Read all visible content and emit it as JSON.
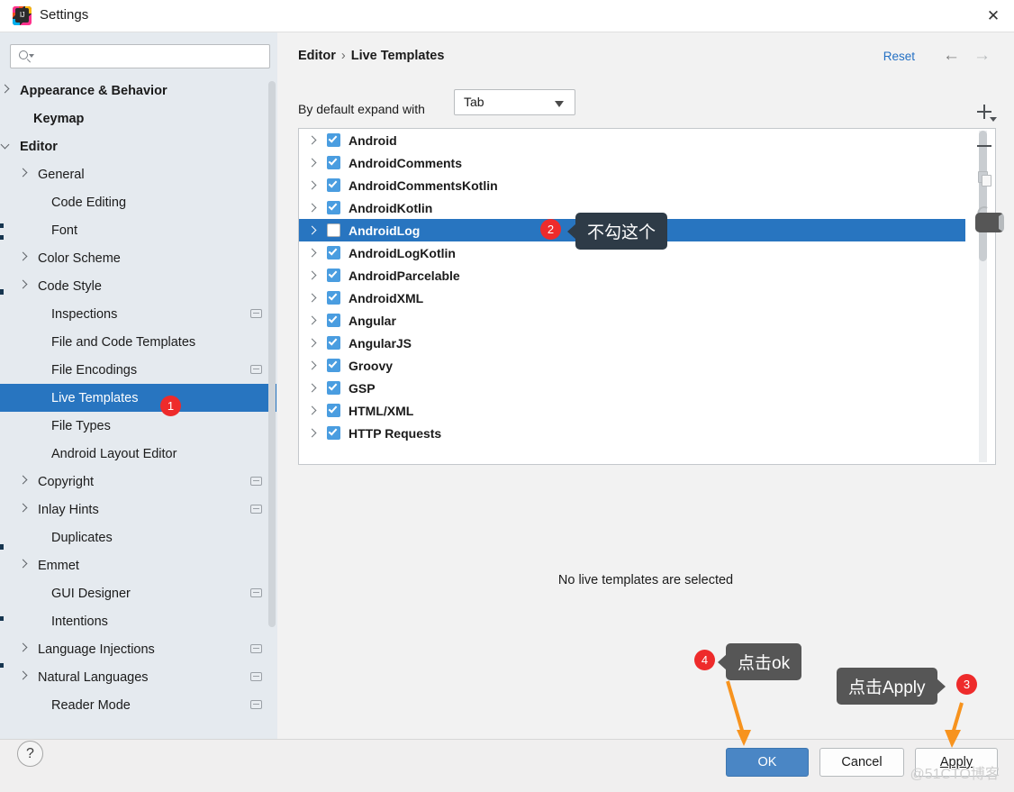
{
  "window": {
    "title": "Settings",
    "close_label": "✕",
    "app_icon": "intellij-idea-icon"
  },
  "sidebar": {
    "search": {
      "placeholder": "",
      "value": ""
    },
    "items": [
      {
        "label": "Appearance & Behavior",
        "indent": 22,
        "chevron": "right",
        "bold": true,
        "selected": false,
        "badge": false
      },
      {
        "label": "Keymap",
        "indent": 37,
        "chevron": "none",
        "bold": true,
        "selected": false,
        "badge": false
      },
      {
        "label": "Editor",
        "indent": 22,
        "chevron": "down",
        "bold": true,
        "selected": false,
        "badge": false
      },
      {
        "label": "General",
        "indent": 42,
        "chevron": "right",
        "bold": false,
        "selected": false,
        "badge": false
      },
      {
        "label": "Code Editing",
        "indent": 57,
        "chevron": "none",
        "bold": false,
        "selected": false,
        "badge": false
      },
      {
        "label": "Font",
        "indent": 57,
        "chevron": "none",
        "bold": false,
        "selected": false,
        "badge": false
      },
      {
        "label": "Color Scheme",
        "indent": 42,
        "chevron": "right",
        "bold": false,
        "selected": false,
        "badge": false
      },
      {
        "label": "Code Style",
        "indent": 42,
        "chevron": "right",
        "bold": false,
        "selected": false,
        "badge": false
      },
      {
        "label": "Inspections",
        "indent": 57,
        "chevron": "none",
        "bold": false,
        "selected": false,
        "badge": true
      },
      {
        "label": "File and Code Templates",
        "indent": 57,
        "chevron": "none",
        "bold": false,
        "selected": false,
        "badge": false
      },
      {
        "label": "File Encodings",
        "indent": 57,
        "chevron": "none",
        "bold": false,
        "selected": false,
        "badge": true
      },
      {
        "label": "Live Templates",
        "indent": 57,
        "chevron": "none",
        "bold": false,
        "selected": true,
        "badge": false
      },
      {
        "label": "File Types",
        "indent": 57,
        "chevron": "none",
        "bold": false,
        "selected": false,
        "badge": false
      },
      {
        "label": "Android Layout Editor",
        "indent": 57,
        "chevron": "none",
        "bold": false,
        "selected": false,
        "badge": false
      },
      {
        "label": "Copyright",
        "indent": 42,
        "chevron": "right",
        "bold": false,
        "selected": false,
        "badge": true
      },
      {
        "label": "Inlay Hints",
        "indent": 42,
        "chevron": "right",
        "bold": false,
        "selected": false,
        "badge": true
      },
      {
        "label": "Duplicates",
        "indent": 57,
        "chevron": "none",
        "bold": false,
        "selected": false,
        "badge": false
      },
      {
        "label": "Emmet",
        "indent": 42,
        "chevron": "right",
        "bold": false,
        "selected": false,
        "badge": false
      },
      {
        "label": "GUI Designer",
        "indent": 57,
        "chevron": "none",
        "bold": false,
        "selected": false,
        "badge": true
      },
      {
        "label": "Intentions",
        "indent": 57,
        "chevron": "none",
        "bold": false,
        "selected": false,
        "badge": false
      },
      {
        "label": "Language Injections",
        "indent": 42,
        "chevron": "right",
        "bold": false,
        "selected": false,
        "badge": true
      },
      {
        "label": "Natural Languages",
        "indent": 42,
        "chevron": "right",
        "bold": false,
        "selected": false,
        "badge": true
      },
      {
        "label": "Reader Mode",
        "indent": 57,
        "chevron": "none",
        "bold": false,
        "selected": false,
        "badge": true
      }
    ]
  },
  "header": {
    "breadcrumb_root": "Editor",
    "breadcrumb_sep": "›",
    "breadcrumb_leaf": "Live Templates",
    "reset_label": "Reset",
    "nav_back": "←",
    "nav_forward": "→"
  },
  "options": {
    "expand_label": "By default expand with",
    "expand_value": "Tab"
  },
  "templates": {
    "rows": [
      {
        "label": "Android",
        "checked": true,
        "selected": false
      },
      {
        "label": "AndroidComments",
        "checked": true,
        "selected": false
      },
      {
        "label": "AndroidCommentsKotlin",
        "checked": true,
        "selected": false
      },
      {
        "label": "AndroidKotlin",
        "checked": true,
        "selected": false
      },
      {
        "label": "AndroidLog",
        "checked": false,
        "selected": true
      },
      {
        "label": "AndroidLogKotlin",
        "checked": true,
        "selected": false
      },
      {
        "label": "AndroidParcelable",
        "checked": true,
        "selected": false
      },
      {
        "label": "AndroidXML",
        "checked": true,
        "selected": false
      },
      {
        "label": "Angular",
        "checked": true,
        "selected": false
      },
      {
        "label": "AngularJS",
        "checked": true,
        "selected": false
      },
      {
        "label": "Groovy",
        "checked": true,
        "selected": false
      },
      {
        "label": "GSP",
        "checked": true,
        "selected": false
      },
      {
        "label": "HTML/XML",
        "checked": true,
        "selected": false
      },
      {
        "label": "HTTP Requests",
        "checked": true,
        "selected": false
      }
    ],
    "toolbar": {
      "add": "add-icon",
      "remove": "remove-icon",
      "copy": "copy-icon",
      "revert": "revert-icon"
    },
    "empty_message": "No live templates are selected"
  },
  "footer": {
    "help_label": "?",
    "ok_label": "OK",
    "cancel_label": "Cancel",
    "apply_label": "Apply"
  },
  "annotations": {
    "badge1": "1",
    "badge2": "2",
    "badge3": "3",
    "badge4": "4",
    "tip_no_check": "不勾这个",
    "tip_click_ok": "点击ok",
    "tip_click_apply": "点击Apply",
    "watermark": "@51CTO博客"
  },
  "colors": {
    "selection_blue": "#2875c0",
    "accent_link": "#2470c4",
    "badge_red": "#ee2b2b",
    "arrow_orange": "#f7931e",
    "checkbox_blue": "#4a9de0",
    "sidebar_bg": "#e5eaef",
    "ok_button": "#4a86c5"
  }
}
